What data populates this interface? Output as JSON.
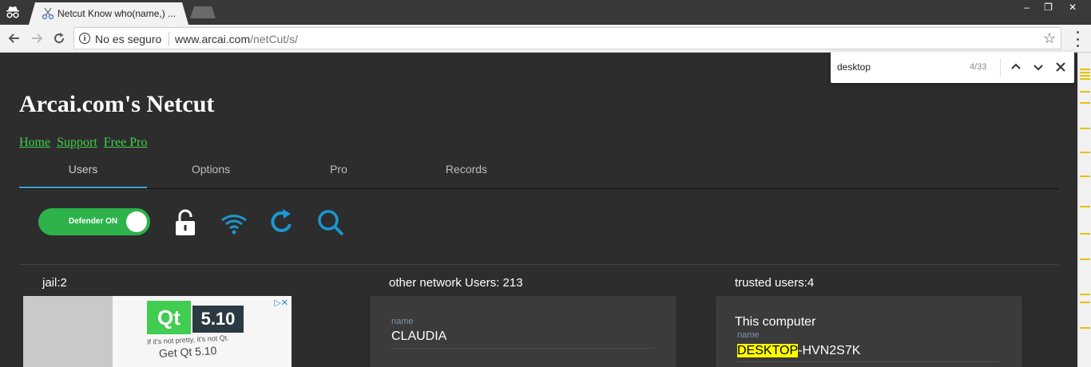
{
  "browser": {
    "tab_title": "Netcut Know who(name,) ...",
    "security_label": "No es seguro",
    "url_domain": "www.arcai.com",
    "url_path": "/netCut/s/",
    "window_controls": [
      "–",
      "❐",
      "✕"
    ]
  },
  "find_bar": {
    "query": "desktop",
    "count": "4/33"
  },
  "site": {
    "title": "Arcai.com's Netcut",
    "links": [
      "Home",
      "Support",
      "Free Pro"
    ],
    "tabs": [
      "Users",
      "Options",
      "Pro",
      "Records"
    ],
    "active_tab": "Users",
    "defender_label": "Defender ON"
  },
  "columns": {
    "jail_header": "jail:2",
    "other_header": "other network Users: 213",
    "trusted_header": "trusted users:4"
  },
  "ad": {
    "logo": "Qt",
    "version": "5.10",
    "tagline": "If it's not pretty, it's not Qt.",
    "cta": "Get Qt 5.10"
  },
  "other_users": {
    "field_label": "name",
    "name": "CLAUDIA"
  },
  "trusted_users": {
    "heading": "This computer",
    "field_label": "name",
    "name_highlight": "DESKTOP",
    "name_rest": "-HVN2S7K"
  },
  "colors": {
    "accent": "#3aa7d9",
    "toggle_on": "#2db34a",
    "link": "#3fd14a",
    "highlight": "#ffff00"
  },
  "icons": [
    "incognito-icon",
    "back-icon",
    "forward-icon",
    "reload-icon",
    "info-icon",
    "star-icon",
    "menu-icon",
    "unlock-icon",
    "wifi-icon",
    "refresh-icon",
    "search-icon"
  ]
}
